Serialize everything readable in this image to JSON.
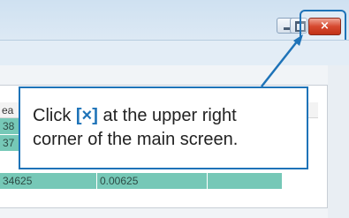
{
  "window": {
    "close_glyph": "×",
    "minimize_icon": "minimize-icon",
    "maximize_icon": "maximize-icon"
  },
  "table": {
    "header_partial": "ea",
    "rows": [
      {
        "c1": "38",
        "c2": "",
        "c3": ""
      },
      {
        "c1": "37",
        "c2": "",
        "c3": ""
      },
      {
        "c1": "34625",
        "c2": "0.00625",
        "c3": ""
      }
    ]
  },
  "callout": {
    "prefix": "Click ",
    "key": "[×]",
    "suffix_line1": " at the upper right",
    "line2": "corner of the main screen."
  },
  "colors": {
    "accent": "#1e73b8",
    "close_red": "#d6492f",
    "row_green": "#76c8b7"
  }
}
